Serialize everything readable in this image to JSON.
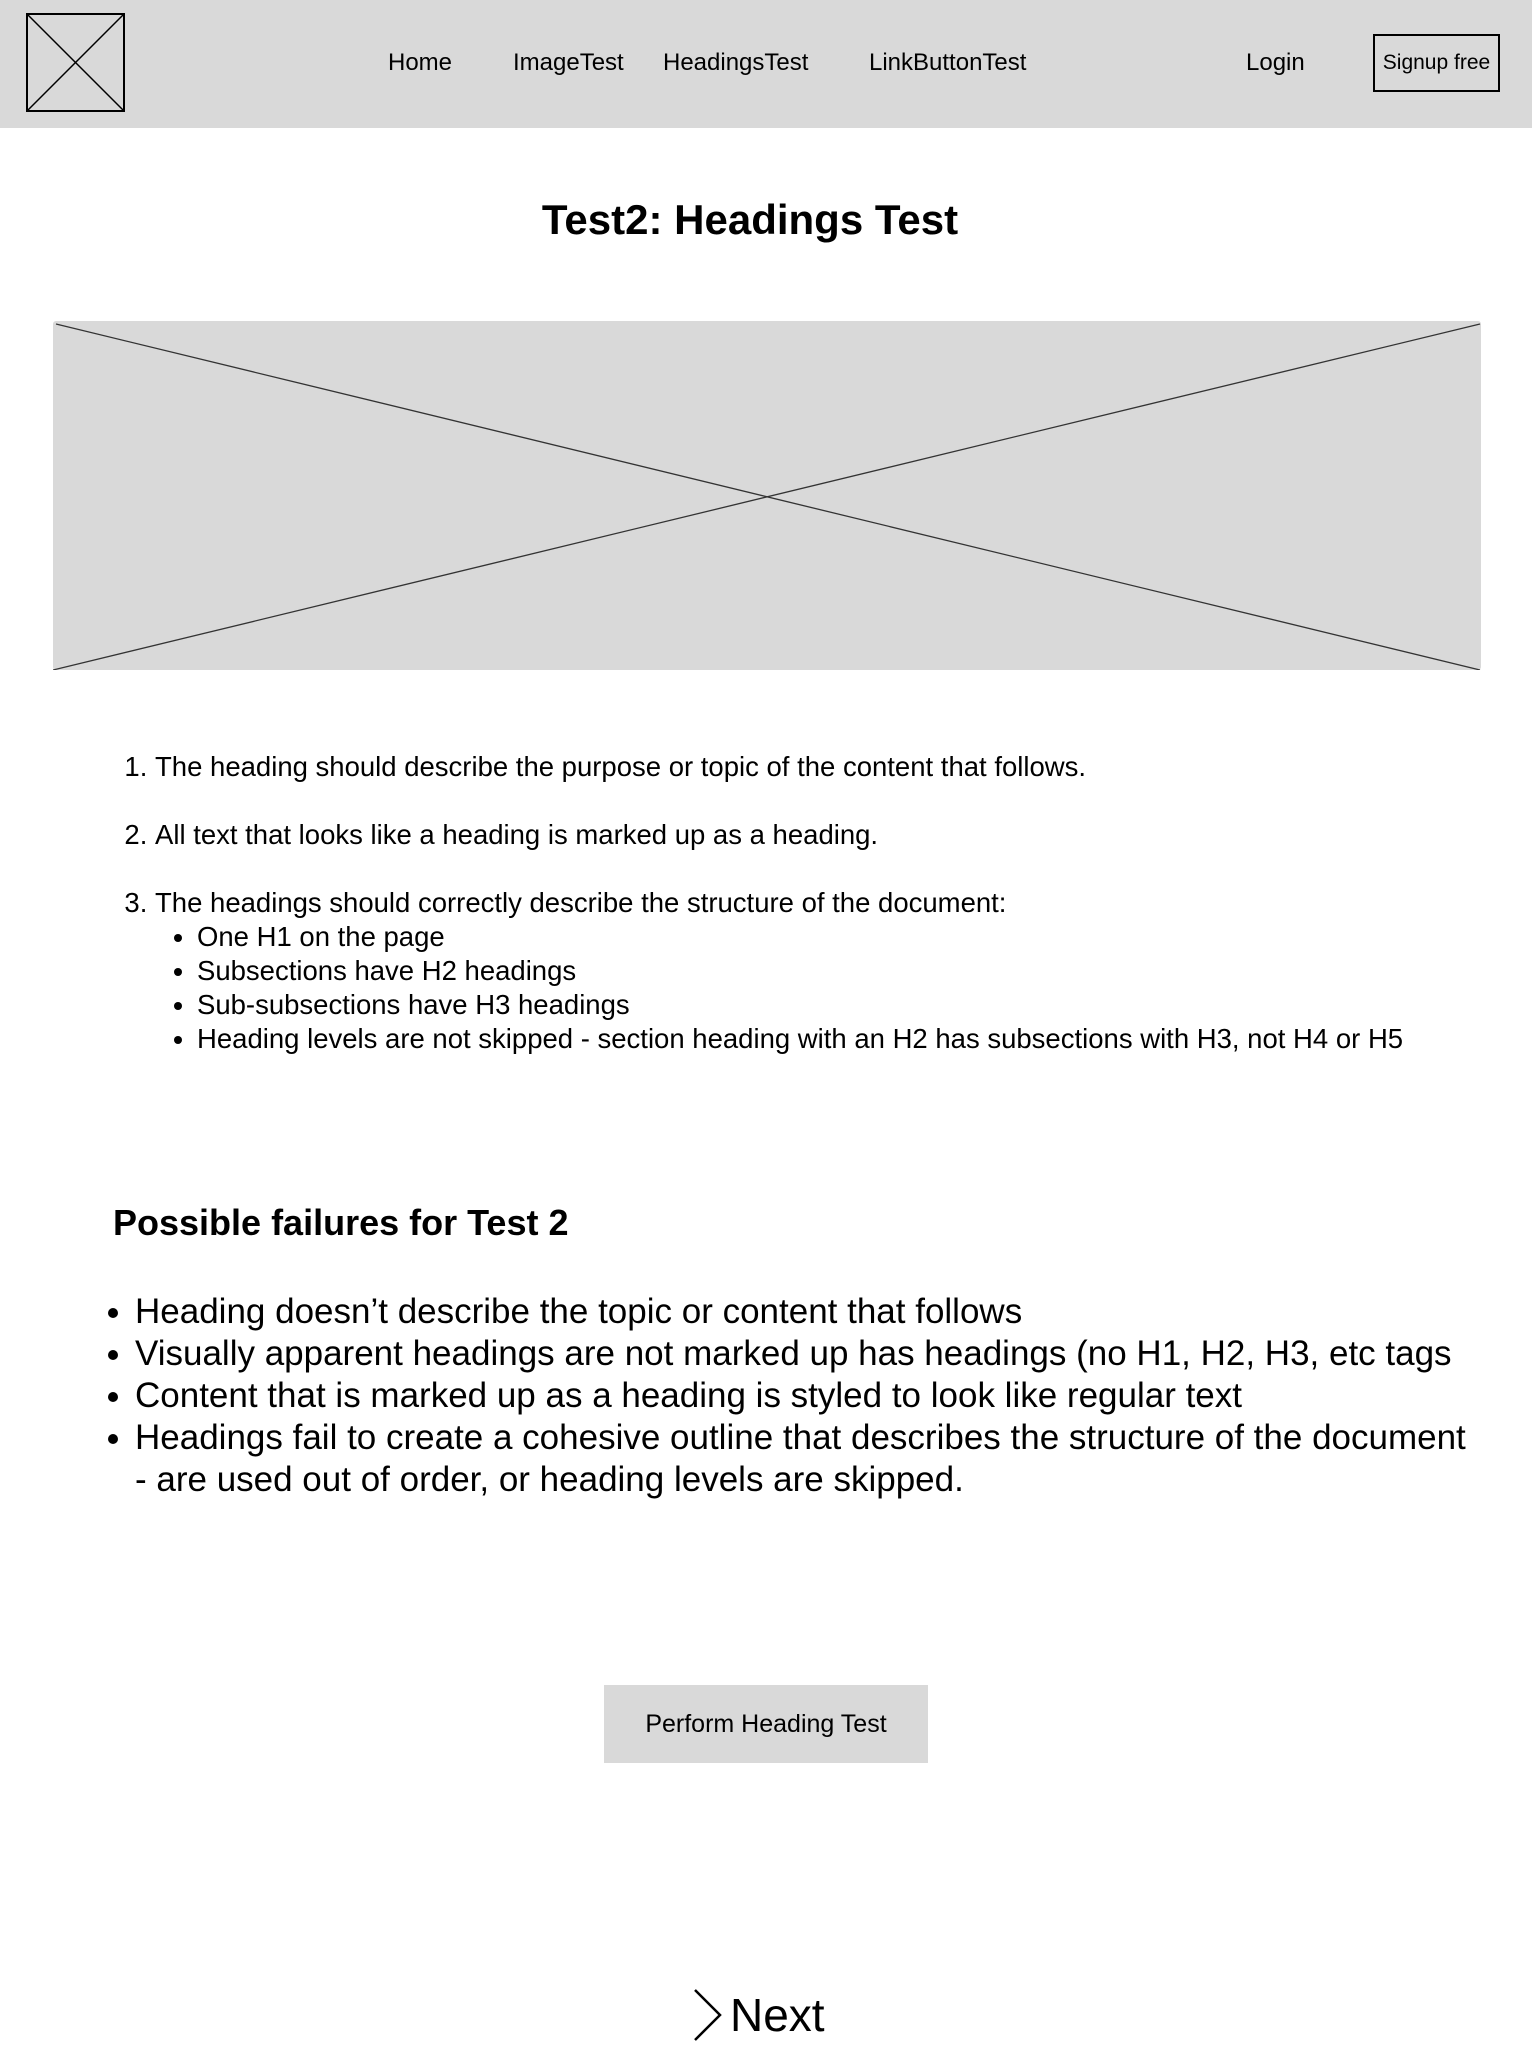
{
  "nav": {
    "links": [
      "Home",
      "ImageTest",
      "HeadingsTest",
      "LinkButtonTest"
    ],
    "login": "Login",
    "signup": "Signup free"
  },
  "main": {
    "title": "Test2: Headings Test",
    "criteria": [
      "The heading should describe the purpose or topic of the content that follows.",
      "All text that looks like a heading is marked up as a heading.",
      "The headings should correctly describe the structure of the document:"
    ],
    "structure_points": [
      "One H1 on the page",
      "Subsections have H2 headings",
      "Sub-subsections have H3 headings",
      "Heading levels are not skipped - section heading with an H2 has subsections with H3, not H4 or H5"
    ],
    "failures_heading": "Possible failures for Test 2",
    "failures": [
      "Heading doesn’t describe the topic or content that follows",
      "Visually apparent headings are not marked up has headings (no H1, H2, H3, etc tags",
      "Content that is marked up as a heading is styled to look like regular text",
      "Headings fail to create a cohesive outline that describes the structure of the document - are used out of order, or heading levels are skipped."
    ],
    "action_button": "Perform Heading Test",
    "next_label": "Next"
  },
  "colors": {
    "placeholder_fill": "#d9d9d9",
    "text": "#000000",
    "background": "#ffffff"
  },
  "icons": {
    "logo": "logo-placeholder-icon",
    "hero": "image-placeholder",
    "next": "chevron-right-icon"
  }
}
